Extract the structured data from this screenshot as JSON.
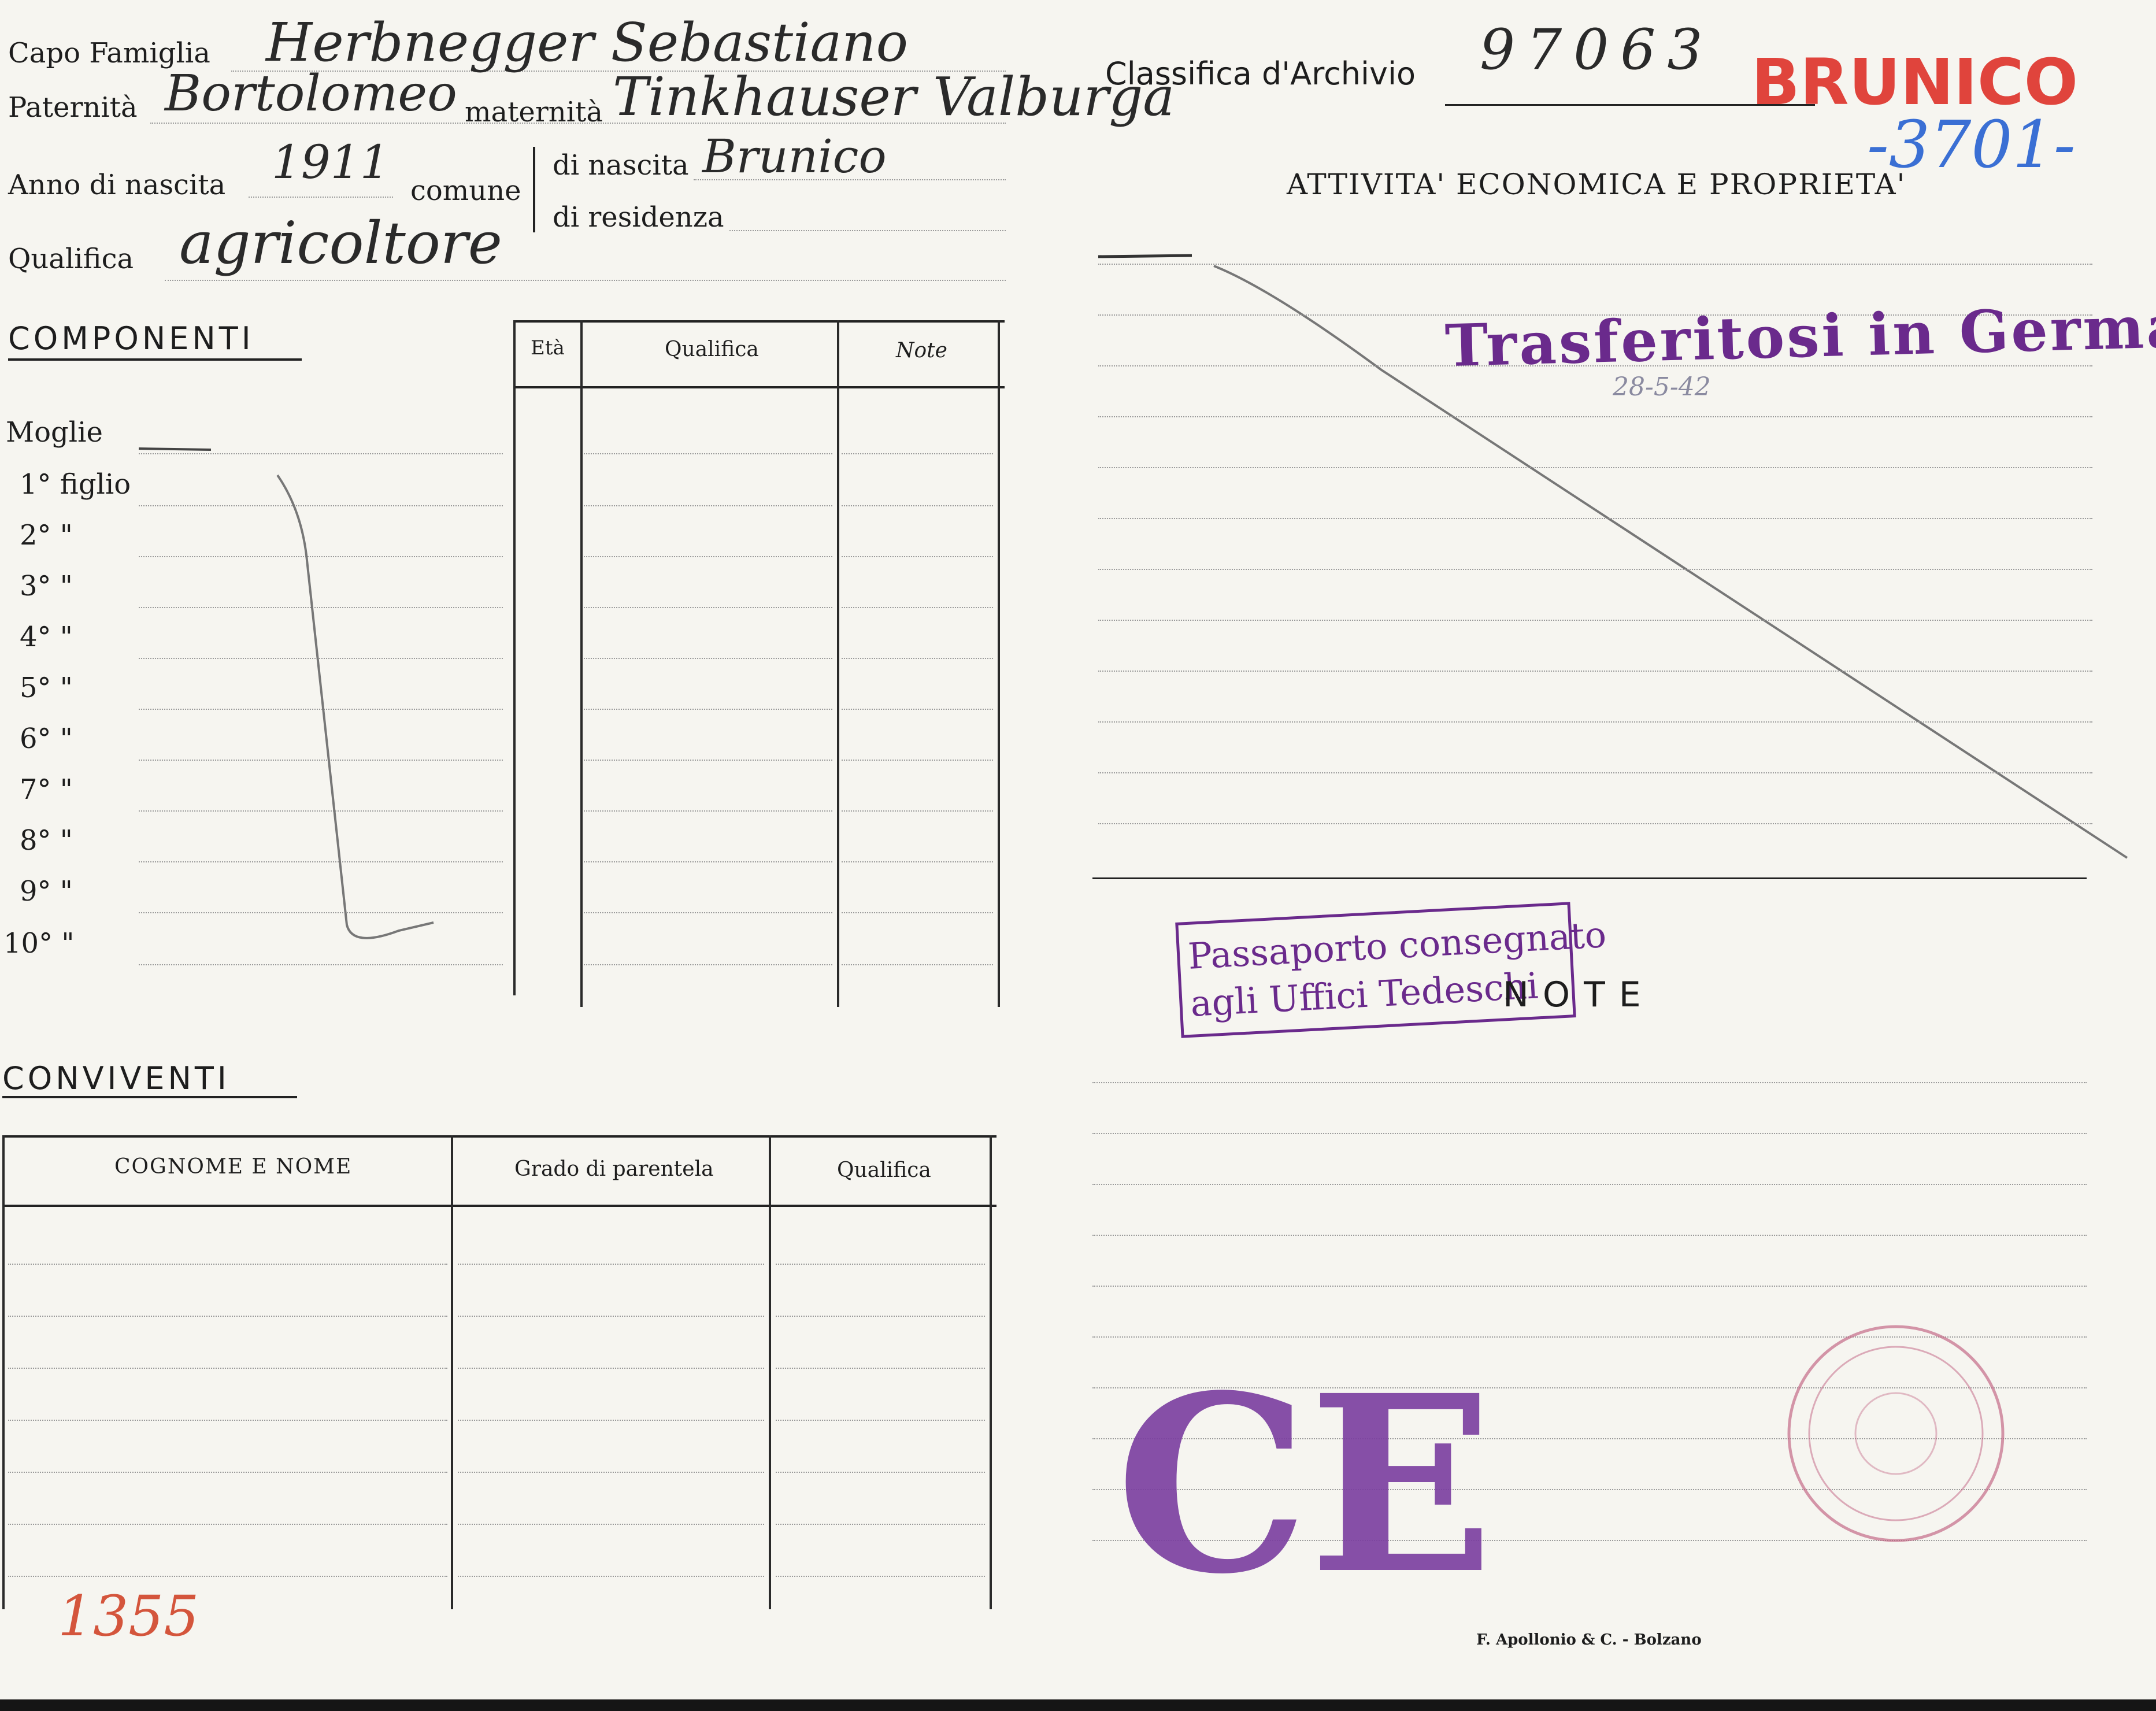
{
  "header": {
    "capo_famiglia_label": "Capo Famiglia",
    "capo_famiglia_value": "Herbnegger Sebastiano",
    "paternita_label": "Paternità",
    "paternita_value": "Bortolomeo",
    "maternita_label": "maternità",
    "maternita_value": "Tinkhauser Valburga",
    "anno_label": "Anno di nascita",
    "anno_value": "1911",
    "comune_label": "comune",
    "di_nascita_label": "di nascita",
    "di_nascita_value": "Brunico",
    "di_residenza_label": "di residenza",
    "qualifica_label": "Qualifica",
    "qualifica_value": "agricoltore"
  },
  "archive": {
    "label": "Classifica d'Archivio",
    "number": "97063",
    "town_stamp": "BRUNICO",
    "ref_number": "-3701-"
  },
  "componenti": {
    "title": "COMPONENTI",
    "table_headers": [
      "Età",
      "Qualifica",
      "Note"
    ],
    "rows": [
      "Moglie",
      "1° figlio",
      "2°  \"",
      "3°  \"",
      "4°  \"",
      "5°  \"",
      "6°  \"",
      "7°  \"",
      "8°  \"",
      "9°  \"",
      "10°  \""
    ]
  },
  "conviventi": {
    "title": "CONVIVENTI",
    "table_headers": [
      "COGNOME E NOME",
      "Grado di parentela",
      "Qualifica"
    ]
  },
  "attivita": {
    "title": "ATTIVITA' ECONOMICA E PROPRIETA'",
    "stamp": "Trasferitosi in Germania",
    "stamp_date": "28-5-42"
  },
  "note": {
    "title": "NOTE",
    "passport_stamp_line1": "Passaporto consegnato",
    "passport_stamp_line2": "agli Uffici Tedeschi",
    "ce_stamp": "CE",
    "printer": "F. Apollonio & C. - Bolzano",
    "bottom_number": "1355"
  },
  "colors": {
    "paper": "#f6f5f0",
    "ink": "#1d1d1d",
    "violet_stamp": "#6a2a8c",
    "red_stamp": "#e0443c",
    "blue_pencil": "#3a6fd4",
    "red_pencil": "#d4553c"
  }
}
